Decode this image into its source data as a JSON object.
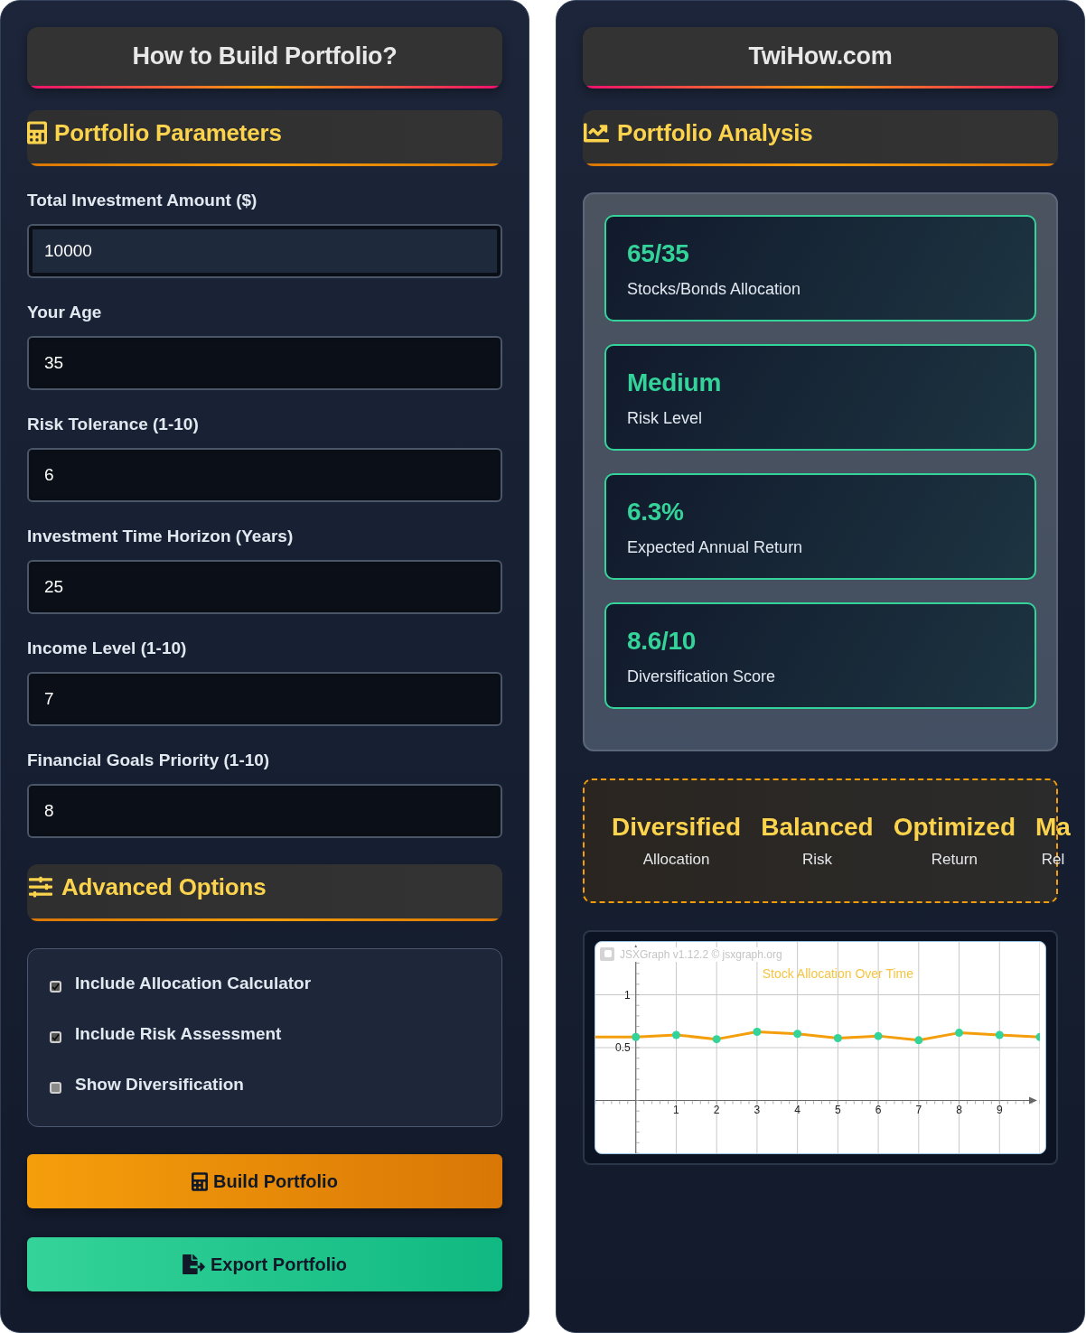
{
  "left_panel": {
    "title": "How to Build Portfolio?",
    "parameters_section": {
      "heading": "Portfolio Parameters",
      "fields": [
        {
          "label": "Total Investment Amount ($)",
          "value": "10000",
          "focused": true
        },
        {
          "label": "Your Age",
          "value": "35",
          "focused": false
        },
        {
          "label": "Risk Tolerance (1-10)",
          "value": "6",
          "focused": false
        },
        {
          "label": "Investment Time Horizon (Years)",
          "value": "25",
          "focused": false
        },
        {
          "label": "Income Level (1-10)",
          "value": "7",
          "focused": false
        },
        {
          "label": "Financial Goals Priority (1-10)",
          "value": "8",
          "focused": false
        }
      ]
    },
    "advanced_section": {
      "heading": "Advanced Options",
      "options": [
        {
          "label": "Include Allocation Calculator",
          "checked": true
        },
        {
          "label": "Include Risk Assessment",
          "checked": true
        },
        {
          "label": "Show Diversification",
          "checked": false
        }
      ]
    },
    "buttons": [
      {
        "label": "Build Portfolio",
        "kind": "build"
      },
      {
        "label": "Export Portfolio",
        "kind": "export"
      }
    ]
  },
  "right_panel": {
    "title": "TwiHow.com",
    "analysis_section": {
      "heading": "Portfolio Analysis",
      "stats": [
        {
          "value": "65/35",
          "label": "Stocks/Bonds Allocation"
        },
        {
          "value": "Medium",
          "label": "Risk Level"
        },
        {
          "value": "6.3%",
          "label": "Expected Annual Return"
        },
        {
          "value": "8.6/10",
          "label": "Diversification Score"
        }
      ]
    },
    "highlights": [
      {
        "title": "Diversified",
        "subtitle": "Allocation"
      },
      {
        "title": "Balanced",
        "subtitle": "Risk"
      },
      {
        "title": "Optimized",
        "subtitle": "Return"
      },
      {
        "title": "Ma",
        "subtitle": "Rel"
      }
    ],
    "chart": {
      "credit": "JSXGraph v1.12.2 © jsxgraph.org",
      "chart_data": {
        "type": "line",
        "title": "Stock Allocation Over Time",
        "grid": true,
        "x": [
          -1,
          0,
          1,
          2,
          3,
          4,
          5,
          6,
          7,
          8,
          9,
          10
        ],
        "series": [
          {
            "color": "#f59e0b",
            "marker": "circle",
            "values": [
              0.6,
              0.6,
              0.62,
              0.58,
              0.65,
              0.63,
              0.59,
              0.61,
              0.57,
              0.64,
              0.62,
              0.6
            ]
          }
        ],
        "xlim": [
          -1,
          10
        ],
        "ylim": [
          -0.5,
          1.5
        ],
        "xticks": [
          1,
          2,
          3,
          4,
          5,
          6,
          7,
          8,
          9
        ],
        "yticks": [
          0.5,
          1
        ]
      }
    }
  }
}
